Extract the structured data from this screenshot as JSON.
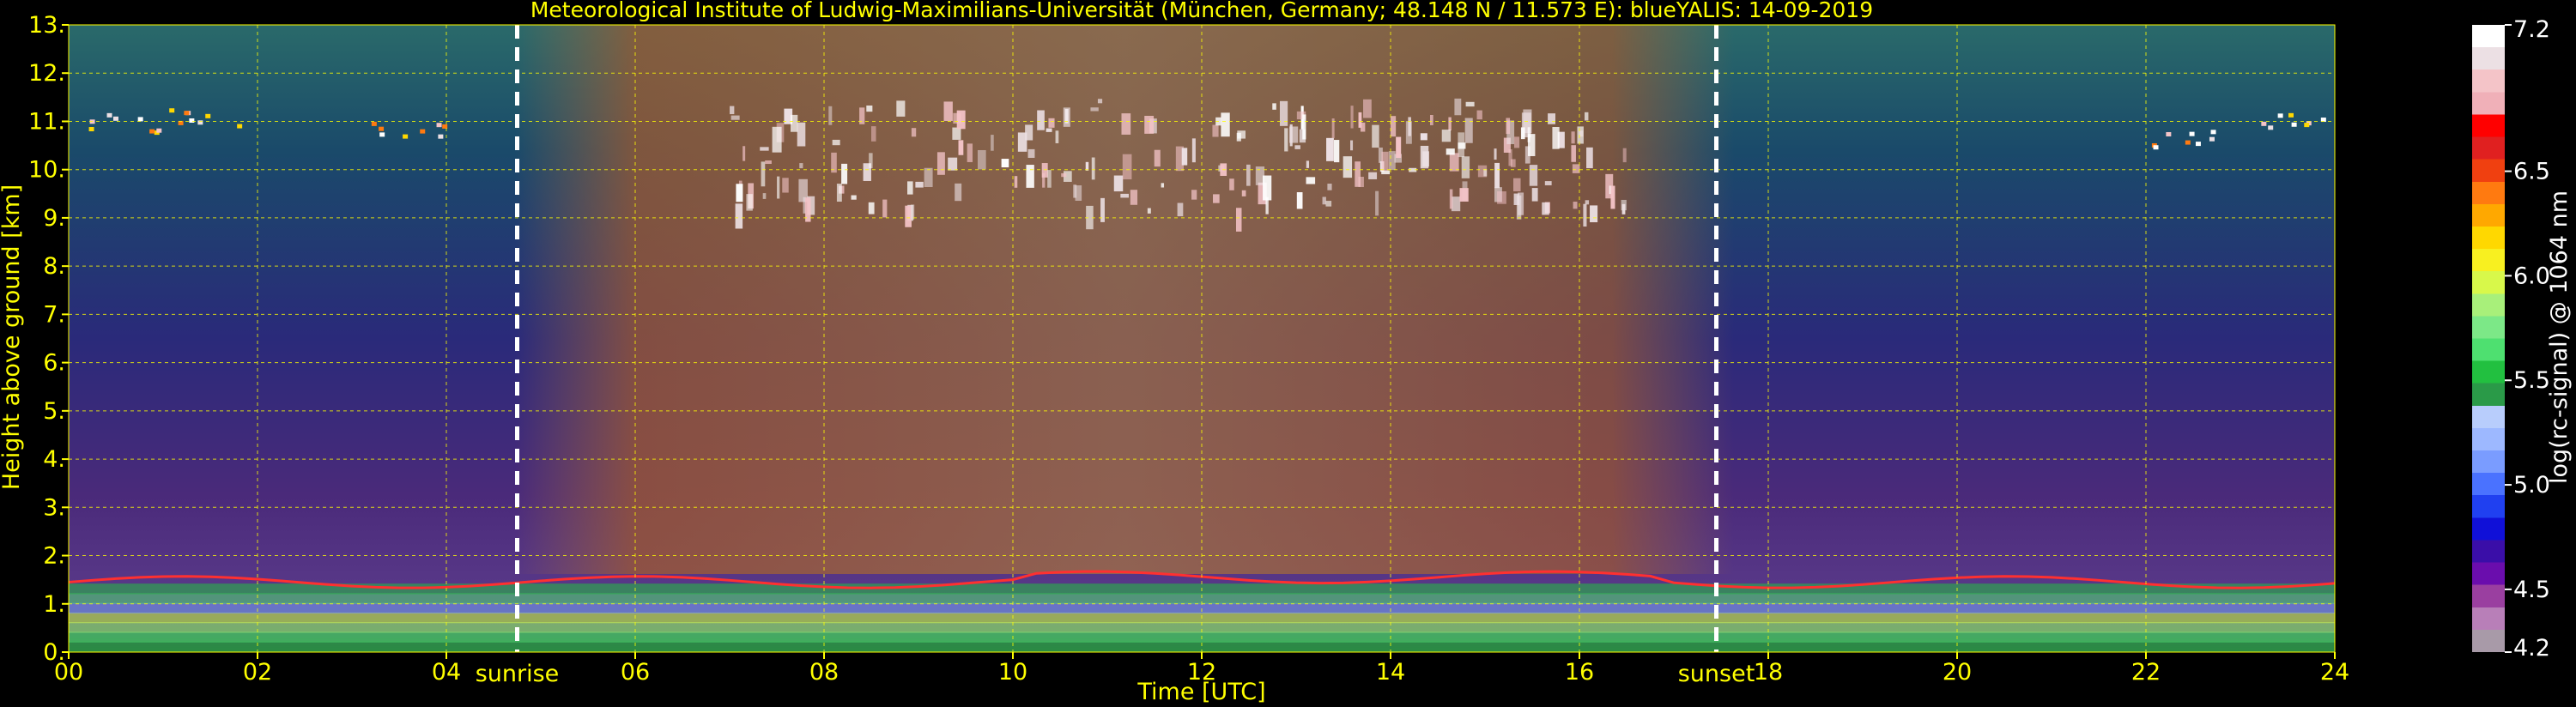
{
  "chart_data": {
    "type": "heatmap",
    "title": "Meteorological Institute of Ludwig-Maximilians-Universität (München, Germany; 48.148 N / 11.573 E):     blueYALIS: 14-09-2019",
    "xlabel": "Time [UTC]",
    "ylabel": "Height above ground [km]",
    "xlim": [
      0,
      24
    ],
    "ylim": [
      0,
      13
    ],
    "x_ticks": [
      "00",
      "02",
      "04",
      "06",
      "08",
      "10",
      "12",
      "14",
      "16",
      "18",
      "20",
      "22",
      "24"
    ],
    "x_tick_values": [
      0,
      2,
      4,
      6,
      8,
      10,
      12,
      14,
      16,
      18,
      20,
      22,
      24
    ],
    "y_ticks": [
      "0.",
      "1.",
      "2.",
      "3.",
      "4.",
      "5.",
      "6.",
      "7.",
      "8.",
      "9.",
      "10.",
      "11.",
      "12.",
      "13."
    ],
    "y_tick_values": [
      0,
      1,
      2,
      3,
      4,
      5,
      6,
      7,
      8,
      9,
      10,
      11,
      12,
      13
    ],
    "grid": true,
    "annotations": [
      {
        "text": "sunrise",
        "x": 4.75
      },
      {
        "text": "sunset",
        "x": 17.45
      }
    ],
    "colorbar": {
      "label": "log(rc-signal) @ 1064 nm",
      "range": [
        4.2,
        7.2
      ],
      "ticks": [
        "7.2",
        "6.5",
        "6.0",
        "5.5",
        "5.0",
        "4.5",
        "4.2"
      ],
      "tick_values": [
        7.2,
        6.5,
        6.0,
        5.5,
        5.0,
        4.5,
        4.2
      ],
      "colors": [
        "#a89aa8",
        "#b87fb8",
        "#9a3fa0",
        "#6a0dad",
        "#3a0ea8",
        "#1010d8",
        "#2040f0",
        "#4a72ff",
        "#7a9cff",
        "#9db8ff",
        "#b8cdfc",
        "#2a9a48",
        "#22c040",
        "#4ee070",
        "#7ce887",
        "#a8f07a",
        "#d8f84a",
        "#f8f020",
        "#ffd800",
        "#ffa800",
        "#ff7a10",
        "#f04010",
        "#e02020",
        "#ff0000",
        "#f0b0b8",
        "#f4c4c8",
        "#ece0e4",
        "#ffffff"
      ]
    }
  },
  "colors": {
    "text": "#ffff00",
    "grid": "#ffff00",
    "background": "#000000"
  }
}
